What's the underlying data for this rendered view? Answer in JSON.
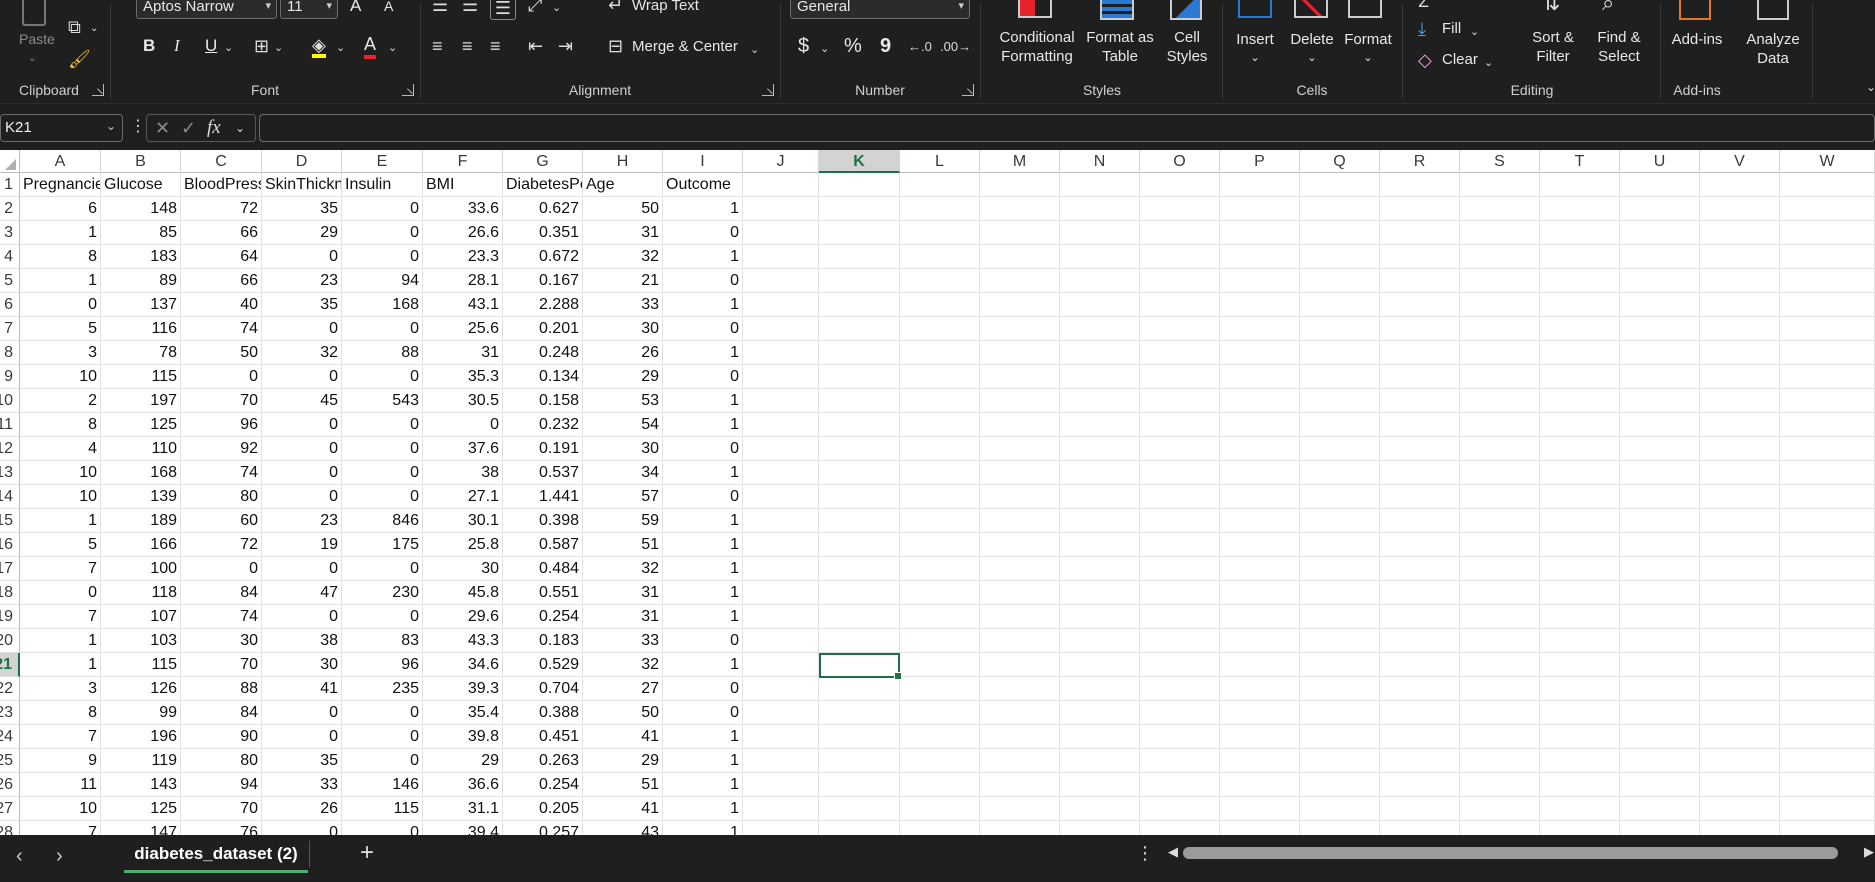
{
  "ribbon": {
    "clipboard": {
      "label": "Clipboard",
      "paste": "Paste"
    },
    "font": {
      "label": "Font",
      "family": "Aptos Narrow",
      "size": "11",
      "grow": "A",
      "shrink": "A"
    },
    "alignment": {
      "label": "Alignment",
      "wrap_text": "Wrap Text",
      "merge_center": "Merge & Center"
    },
    "number": {
      "label": "Number",
      "format": "General",
      "currency": "$",
      "percent": "%",
      "comma": "9"
    },
    "styles": {
      "label": "Styles",
      "conditional_line1": "Conditional",
      "conditional_line2": "Formatting",
      "format_table_line1": "Format as",
      "format_table_line2": "Table",
      "cell_styles_line1": "Cell",
      "cell_styles_line2": "Styles"
    },
    "cells": {
      "label": "Cells",
      "insert": "Insert",
      "delete": "Delete",
      "format": "Format"
    },
    "editing": {
      "label": "Editing",
      "fill": "Fill",
      "clear": "Clear",
      "sort_line1": "Sort &",
      "sort_line2": "Filter",
      "find_line1": "Find &",
      "find_line2": "Select"
    },
    "addins": {
      "label": "Add-ins",
      "addins_btn": "Add-ins",
      "analyze_line1": "Analyze",
      "analyze_line2": "Data"
    }
  },
  "formula_bar": {
    "name_box": "K21",
    "fx": "fx",
    "value": ""
  },
  "columns": [
    "A",
    "B",
    "C",
    "D",
    "E",
    "F",
    "G",
    "H",
    "I",
    "J",
    "K",
    "L",
    "M",
    "N",
    "O",
    "P",
    "Q",
    "R",
    "S",
    "T",
    "U",
    "V",
    "W"
  ],
  "active_column": "K",
  "active_row": "21",
  "headers": [
    "Pregnancies",
    "Glucose",
    "BloodPressure",
    "SkinThickness",
    "Insulin",
    "BMI",
    "DiabetesPedigreeFunction",
    "Age",
    "Outcome"
  ],
  "rows": [
    [
      "6",
      "148",
      "72",
      "35",
      "0",
      "33.6",
      "0.627",
      "50",
      "1"
    ],
    [
      "1",
      "85",
      "66",
      "29",
      "0",
      "26.6",
      "0.351",
      "31",
      "0"
    ],
    [
      "8",
      "183",
      "64",
      "0",
      "0",
      "23.3",
      "0.672",
      "32",
      "1"
    ],
    [
      "1",
      "89",
      "66",
      "23",
      "94",
      "28.1",
      "0.167",
      "21",
      "0"
    ],
    [
      "0",
      "137",
      "40",
      "35",
      "168",
      "43.1",
      "2.288",
      "33",
      "1"
    ],
    [
      "5",
      "116",
      "74",
      "0",
      "0",
      "25.6",
      "0.201",
      "30",
      "0"
    ],
    [
      "3",
      "78",
      "50",
      "32",
      "88",
      "31",
      "0.248",
      "26",
      "1"
    ],
    [
      "10",
      "115",
      "0",
      "0",
      "0",
      "35.3",
      "0.134",
      "29",
      "0"
    ],
    [
      "2",
      "197",
      "70",
      "45",
      "543",
      "30.5",
      "0.158",
      "53",
      "1"
    ],
    [
      "8",
      "125",
      "96",
      "0",
      "0",
      "0",
      "0.232",
      "54",
      "1"
    ],
    [
      "4",
      "110",
      "92",
      "0",
      "0",
      "37.6",
      "0.191",
      "30",
      "0"
    ],
    [
      "10",
      "168",
      "74",
      "0",
      "0",
      "38",
      "0.537",
      "34",
      "1"
    ],
    [
      "10",
      "139",
      "80",
      "0",
      "0",
      "27.1",
      "1.441",
      "57",
      "0"
    ],
    [
      "1",
      "189",
      "60",
      "23",
      "846",
      "30.1",
      "0.398",
      "59",
      "1"
    ],
    [
      "5",
      "166",
      "72",
      "19",
      "175",
      "25.8",
      "0.587",
      "51",
      "1"
    ],
    [
      "7",
      "100",
      "0",
      "0",
      "0",
      "30",
      "0.484",
      "32",
      "1"
    ],
    [
      "0",
      "118",
      "84",
      "47",
      "230",
      "45.8",
      "0.551",
      "31",
      "1"
    ],
    [
      "7",
      "107",
      "74",
      "0",
      "0",
      "29.6",
      "0.254",
      "31",
      "1"
    ],
    [
      "1",
      "103",
      "30",
      "38",
      "83",
      "43.3",
      "0.183",
      "33",
      "0"
    ],
    [
      "1",
      "115",
      "70",
      "30",
      "96",
      "34.6",
      "0.529",
      "32",
      "1"
    ],
    [
      "3",
      "126",
      "88",
      "41",
      "235",
      "39.3",
      "0.704",
      "27",
      "0"
    ],
    [
      "8",
      "99",
      "84",
      "0",
      "0",
      "35.4",
      "0.388",
      "50",
      "0"
    ],
    [
      "7",
      "196",
      "90",
      "0",
      "0",
      "39.8",
      "0.451",
      "41",
      "1"
    ],
    [
      "9",
      "119",
      "80",
      "35",
      "0",
      "29",
      "0.263",
      "29",
      "1"
    ],
    [
      "11",
      "143",
      "94",
      "33",
      "146",
      "36.6",
      "0.254",
      "51",
      "1"
    ],
    [
      "10",
      "125",
      "70",
      "26",
      "115",
      "31.1",
      "0.205",
      "41",
      "1"
    ],
    [
      "7",
      "147",
      "76",
      "0",
      "0",
      "39.4",
      "0.257",
      "43",
      "1"
    ]
  ],
  "sheet_tabs": {
    "active": "diabetes_dataset (2)",
    "add": "+",
    "more": "⋮"
  }
}
